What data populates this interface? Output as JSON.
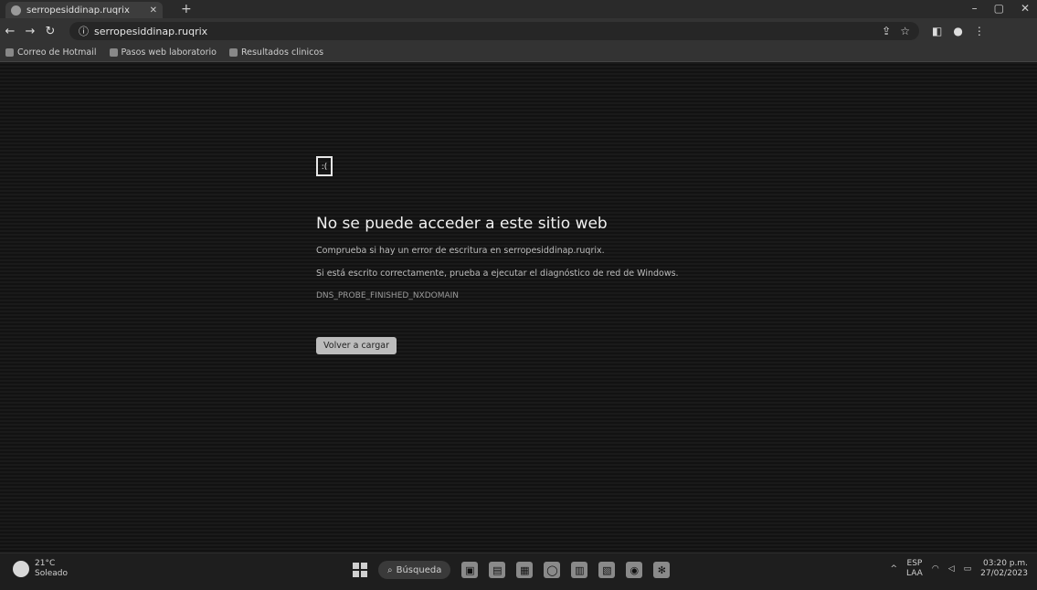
{
  "browser": {
    "tab_title": "serropesiddinap.ruqrix",
    "url": "serropesiddinap.ruqrix",
    "bookmarks": [
      "Correo de Hotmail",
      "Pasos web laboratorio",
      "Resultados clinicos"
    ]
  },
  "error_page": {
    "icon": "sad-file-icon",
    "title": "No se puede acceder a este sitio web",
    "line1": "Comprueba si hay un error de escritura en serropesiddinap.ruqrix.",
    "line2": "Si está escrito correctamente, prueba a ejecutar el diagnóstico de red de Windows.",
    "error_code": "DNS_PROBE_FINISHED_NXDOMAIN",
    "reload_label": "Volver a cargar"
  },
  "taskbar": {
    "weather_temp": "21°C",
    "weather_desc": "Soleado",
    "search_label": "Búsqueda",
    "lang_top": "ESP",
    "lang_bottom": "LAA",
    "time": "03:20 p.m.",
    "date": "27/02/2023"
  }
}
